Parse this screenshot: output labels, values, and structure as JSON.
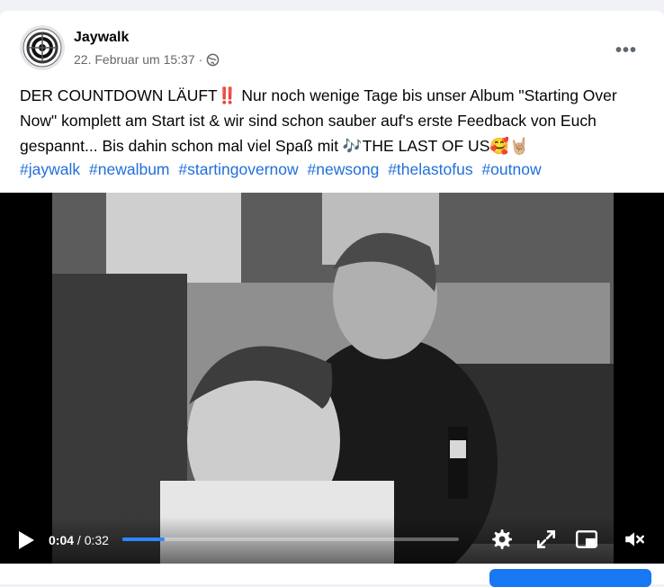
{
  "post": {
    "author": "Jaywalk",
    "date": "22. Februar um 15:37",
    "meta_separator": "·",
    "audience_icon": "globe-icon",
    "more_icon": "more-options-icon",
    "more_label": "•••",
    "text": "DER COUNTDOWN LÄUFT‼️ Nur noch wenige Tage bis unser Album \"Starting Over Now\" komplett am Start ist & wir sind schon sauber auf's erste Feedback von Euch gespannt... Bis dahin schon mal viel Spaß mit 🎶THE LAST OF US🥰🤘🏼",
    "hashtags": [
      "#jaywalk",
      "#newalbum",
      "#startingovernow",
      "#newsong",
      "#thelastofus",
      "#outnow"
    ]
  },
  "video": {
    "current_time": "0:04",
    "separator": " / ",
    "duration": "0:32",
    "progress_fraction": 0.125,
    "controls": [
      "play-icon",
      "settings-icon",
      "fullscreen-icon",
      "picture-in-picture-icon",
      "mute-icon"
    ]
  },
  "colors": {
    "link": "#216fdb",
    "progress": "#2d88ff",
    "meta": "#65676b",
    "accent": "#1877f2"
  }
}
